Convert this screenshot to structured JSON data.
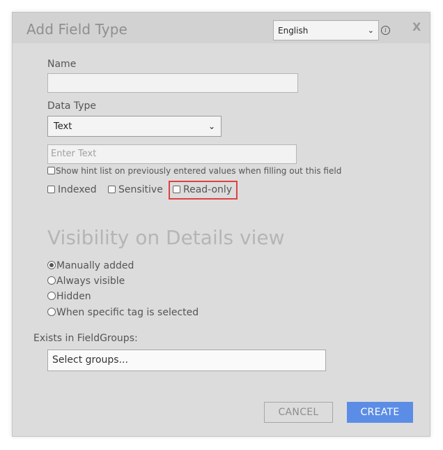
{
  "dialog": {
    "title": "Add Field Type",
    "language": "English",
    "close_label": "X"
  },
  "form": {
    "name_label": "Name",
    "name_value": "",
    "data_type_label": "Data Type",
    "data_type_value": "Text",
    "default_placeholder": "Enter Text",
    "hint_checkbox_label": "Show hint list on previously entered values when filling out this field",
    "indexed_label": "Indexed",
    "sensitive_label": "Sensitive",
    "readonly_label": "Read-only"
  },
  "visibility": {
    "title": "Visibility on Details view",
    "options": [
      {
        "label": "Manually added",
        "checked": true
      },
      {
        "label": "Always visible",
        "checked": false
      },
      {
        "label": "Hidden",
        "checked": false
      },
      {
        "label": "When specific tag is selected",
        "checked": false
      }
    ]
  },
  "groups": {
    "label": "Exists in FieldGroups:",
    "placeholder": "Select groups..."
  },
  "buttons": {
    "cancel": "CANCEL",
    "create": "CREATE"
  },
  "colors": {
    "primary": "#5b8de6",
    "highlight": "#e04040"
  }
}
